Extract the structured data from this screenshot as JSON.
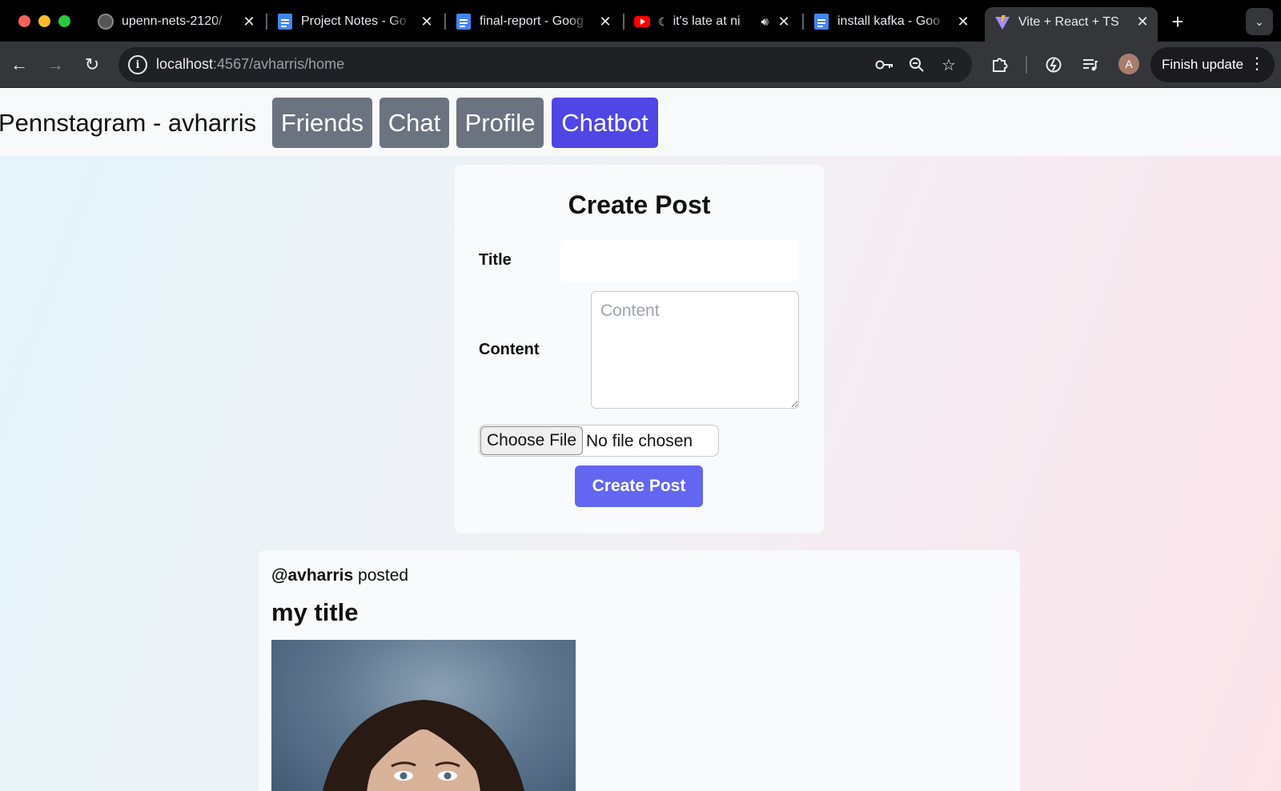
{
  "browser": {
    "tabs": [
      {
        "title": "upenn-nets-2120/",
        "icon": "github-icon"
      },
      {
        "title": "Project Notes - Go",
        "icon": "docs-icon"
      },
      {
        "title": "final-report - Goog",
        "icon": "docs-icon"
      },
      {
        "title": "it's late at ni",
        "icon": "youtube-icon"
      },
      {
        "title": "install kafka - Goo",
        "icon": "docs-icon"
      },
      {
        "title": "Vite + React + TS",
        "icon": "vite-icon"
      }
    ],
    "active_tab_index": 5,
    "url_host": "localhost",
    "url_rest": ":4567/avharris/home",
    "profile_initial": "A",
    "finish_update_label": "Finish update"
  },
  "app": {
    "title": "Pennstagram - avharris",
    "nav": [
      "Friends",
      "Chat",
      "Profile",
      "Chatbot"
    ],
    "active_nav": "Chatbot"
  },
  "create_post": {
    "heading": "Create Post",
    "title_label": "Title",
    "title_value": "",
    "content_label": "Content",
    "content_placeholder": "Content",
    "choose_file_label": "Choose File",
    "file_status": "No file chosen",
    "submit_label": "Create Post"
  },
  "post": {
    "handle": "@avharris",
    "action": "posted",
    "title": "my title"
  },
  "colors": {
    "accent": "#4f46e5",
    "submit": "#6366f1",
    "nav_inactive": "#6b7280"
  }
}
